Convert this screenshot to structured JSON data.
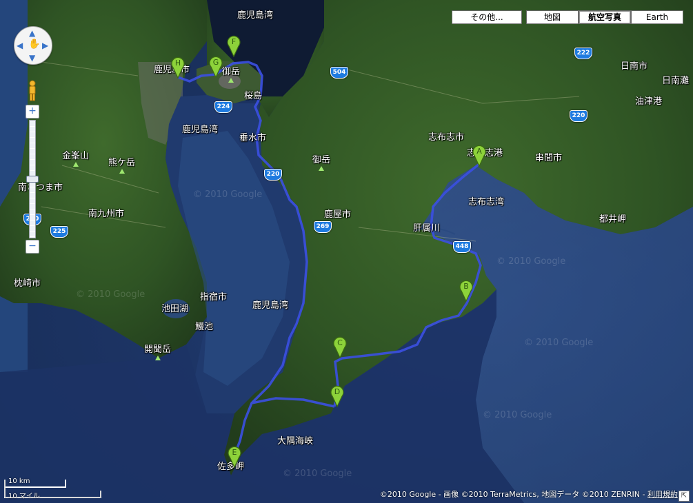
{
  "map_types": {
    "more": "その他...",
    "map": "地図",
    "satellite": "航空写真",
    "earth": "Earth",
    "active": "satellite"
  },
  "place_labels": [
    {
      "id": "kagoshima-bay-north",
      "text": "鹿児島湾"
    },
    {
      "id": "kagoshima-city",
      "text": "鹿児島市"
    },
    {
      "id": "ontake-sakurajima",
      "text": "御岳"
    },
    {
      "id": "sakurajima",
      "text": "桜島"
    },
    {
      "id": "kagoshima-bay-west",
      "text": "鹿児島湾"
    },
    {
      "id": "tarumizu",
      "text": "垂水市"
    },
    {
      "id": "kinposan",
      "text": "金峯山"
    },
    {
      "id": "kenagatake",
      "text": "熊ケ岳"
    },
    {
      "id": "minamisatsuma",
      "text": "南さつま市"
    },
    {
      "id": "minamikyushu",
      "text": "南九州市"
    },
    {
      "id": "makurazaki",
      "text": "枕崎市"
    },
    {
      "id": "ikedako",
      "text": "池田湖"
    },
    {
      "id": "ibusuki",
      "text": "指宿市"
    },
    {
      "id": "unagiike",
      "text": "鰻池"
    },
    {
      "id": "kaimondake",
      "text": "開聞岳"
    },
    {
      "id": "kagoshima-bay-south",
      "text": "鹿児島湾"
    },
    {
      "id": "kanoya",
      "text": "鹿屋市"
    },
    {
      "id": "ontake-osumi",
      "text": "御岳"
    },
    {
      "id": "shibushi-city",
      "text": "志布志市"
    },
    {
      "id": "shibushi-port",
      "text": "志布志港"
    },
    {
      "id": "shibushi-bay",
      "text": "志布志湾"
    },
    {
      "id": "kushima",
      "text": "串間市"
    },
    {
      "id": "toimisaki",
      "text": "都井岬"
    },
    {
      "id": "kimotsukigawa",
      "text": "肝属川"
    },
    {
      "id": "nichinan",
      "text": "日南市"
    },
    {
      "id": "aburatsu",
      "text": "油津港"
    },
    {
      "id": "nichinan-bay",
      "text": "日南灘"
    },
    {
      "id": "osumi-strait",
      "text": "大隅海峡"
    },
    {
      "id": "satamisaki",
      "text": "佐多岬"
    }
  ],
  "route_markers": [
    "A",
    "B",
    "C",
    "D",
    "E",
    "F",
    "G",
    "H"
  ],
  "route_color": "#3b4fe0",
  "marker_color": "#8dd23a",
  "highway_shields": [
    "504",
    "224",
    "220",
    "269",
    "220",
    "225",
    "222",
    "220",
    "448"
  ],
  "watermarks": [
    "© 2010 Google",
    "© 2010 Google",
    "© 2010 Google",
    "© 2010 Google",
    "© 2010 Google",
    "© 2010 Google"
  ],
  "scale": {
    "km": "10 km",
    "miles": "10 マイル"
  },
  "attribution": {
    "text": "©2010 Google - 画像 ©2010 TerraMetrics, 地図データ ©2010 ZENRIN - ",
    "terms_link": "利用規約"
  }
}
